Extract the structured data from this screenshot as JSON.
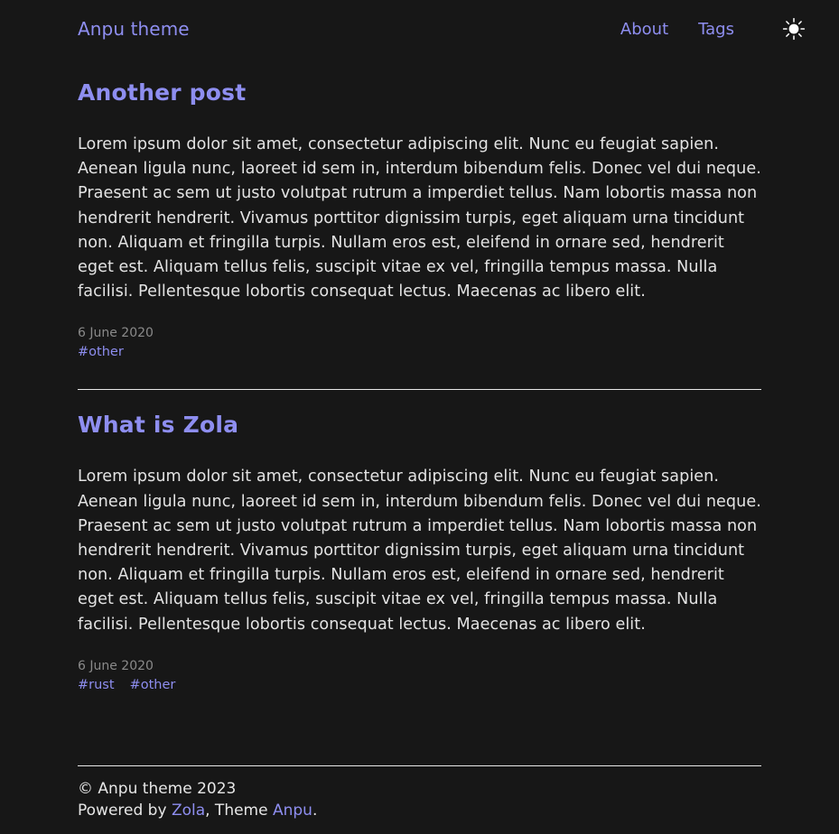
{
  "header": {
    "site_title": "Anpu theme",
    "nav": [
      {
        "label": "About"
      },
      {
        "label": "Tags"
      }
    ],
    "theme_toggle": {
      "icon": "sun-icon"
    }
  },
  "colors": {
    "background": "#171717",
    "accent_link": "#8e8ef0",
    "body_text": "#e3e3e3",
    "muted_text": "#8a8a8a",
    "divider": "#e8e8e8"
  },
  "posts": [
    {
      "title": "Another post",
      "body": "Lorem ipsum dolor sit amet, consectetur adipiscing elit. Nunc eu feugiat sapien. Aenean ligula nunc, laoreet id sem in, interdum bibendum felis. Donec vel dui neque. Praesent ac sem ut justo volutpat rutrum a imperdiet tellus. Nam lobortis massa non hendrerit hendrerit. Vivamus porttitor dignissim turpis, eget aliquam urna tincidunt non. Aliquam et fringilla turpis. Nullam eros est, eleifend in ornare sed, hendrerit eget est. Aliquam tellus felis, suscipit vitae ex vel, fringilla tempus massa. Nulla facilisi. Pellentesque lobortis consequat lectus. Maecenas ac libero elit.",
      "date": "6 June 2020",
      "tags": [
        "#other"
      ]
    },
    {
      "title": "What is Zola",
      "body": "Lorem ipsum dolor sit amet, consectetur adipiscing elit. Nunc eu feugiat sapien. Aenean ligula nunc, laoreet id sem in, interdum bibendum felis. Donec vel dui neque. Praesent ac sem ut justo volutpat rutrum a imperdiet tellus. Nam lobortis massa non hendrerit hendrerit. Vivamus porttitor dignissim turpis, eget aliquam urna tincidunt non. Aliquam et fringilla turpis. Nullam eros est, eleifend in ornare sed, hendrerit eget est. Aliquam tellus felis, suscipit vitae ex vel, fringilla tempus massa. Nulla facilisi. Pellentesque lobortis consequat lectus. Maecenas ac libero elit.",
      "date": "6 June 2020",
      "tags": [
        "#rust",
        "#other"
      ]
    }
  ],
  "footer": {
    "copyright": "© Anpu theme 2023",
    "powered_prefix": "Powered by ",
    "engine_link": "Zola",
    "theme_prefix": ", Theme ",
    "theme_link": "Anpu",
    "suffix": "."
  }
}
